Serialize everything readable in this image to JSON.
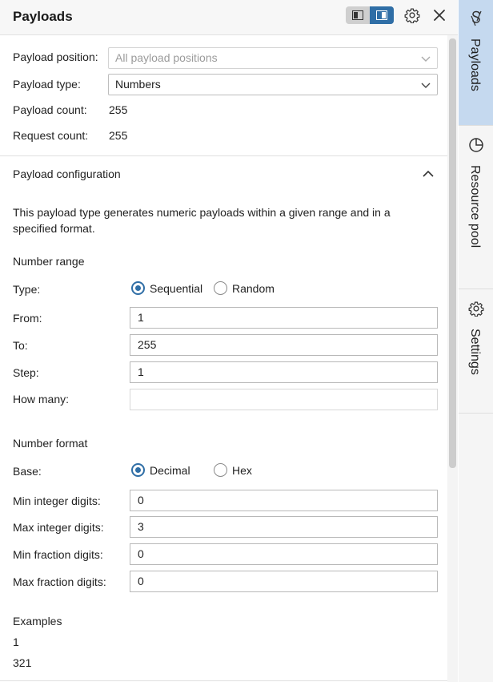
{
  "header": {
    "title": "Payloads"
  },
  "summary": {
    "position_label": "Payload position:",
    "position_value": "All payload positions",
    "type_label": "Payload type:",
    "type_value": "Numbers",
    "count_label": "Payload count:",
    "count_value": "255",
    "request_label": "Request count:",
    "request_value": "255"
  },
  "config": {
    "title": "Payload configuration",
    "description_line1": "This payload type generates numeric payloads within a given range and in a",
    "description_line2": "specified format.",
    "range": {
      "heading": "Number range",
      "type_label": "Type:",
      "sequential": "Sequential",
      "random": "Random",
      "selected": "Sequential",
      "from_label": "From:",
      "from_value": "1",
      "to_label": "To:",
      "to_value": "255",
      "step_label": "Step:",
      "step_value": "1",
      "howmany_label": "How many:",
      "howmany_value": ""
    },
    "format": {
      "heading": "Number format",
      "base_label": "Base:",
      "decimal": "Decimal",
      "hex": "Hex",
      "selected": "Decimal",
      "min_int_label": "Min integer digits:",
      "min_int_value": "0",
      "max_int_label": "Max integer digits:",
      "max_int_value": "3",
      "min_frac_label": "Min fraction digits:",
      "min_frac_value": "0",
      "max_frac_label": "Max fraction digits:",
      "max_frac_value": "0"
    },
    "examples": {
      "heading": "Examples",
      "items": [
        "1",
        "321"
      ]
    }
  },
  "sidebar": {
    "tabs": [
      {
        "label": "Payloads",
        "active": true
      },
      {
        "label": "Resource pool",
        "active": false
      },
      {
        "label": "Settings",
        "active": false
      }
    ]
  },
  "colors": {
    "accent": "#2f6ea6",
    "active_tab": "#c5d9ef"
  }
}
